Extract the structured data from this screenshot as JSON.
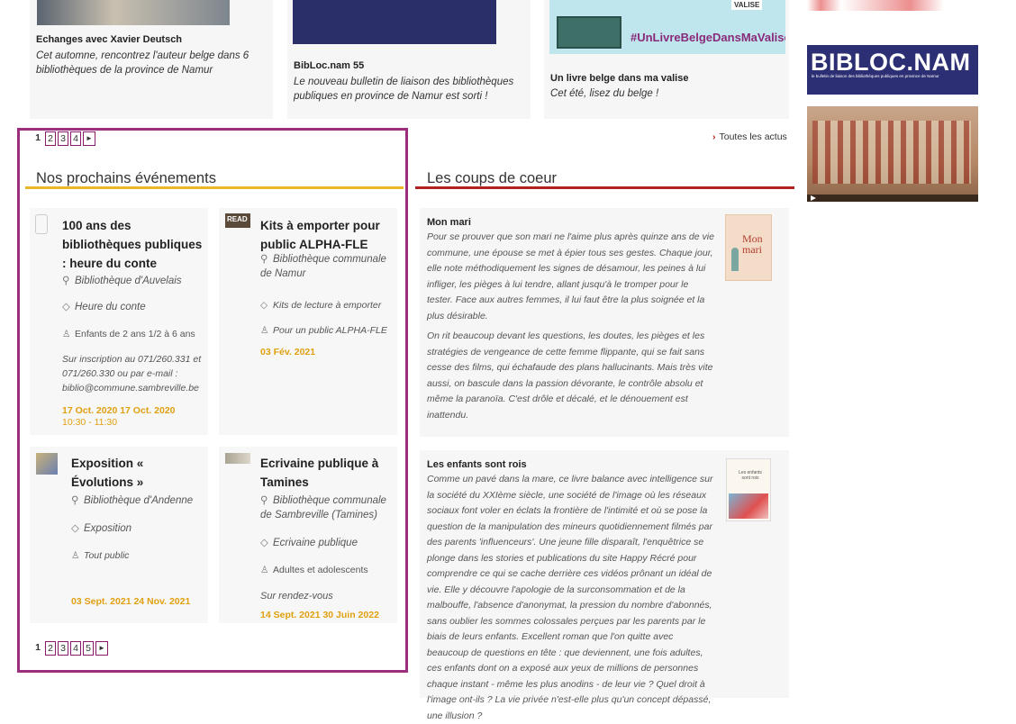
{
  "news": [
    {
      "title": "Echanges avec Xavier Deutsch",
      "desc": "Cet automne, rencontrez l'auteur belge dans 6 bibliothèques de la province de Namur"
    },
    {
      "title": "BibLoc.nam 55",
      "desc": "Le nouveau bulletin de liaison des bibliothèques publiques en province de Namur est sorti !"
    },
    {
      "title": "Un livre belge dans ma valise",
      "desc": "Cet été, lisez du belge !",
      "banner_text": "#UnLivreBelgeDansMaValise",
      "banner_tag": "VALISE"
    }
  ],
  "sidebar": {
    "bibloc_title": "BIBLOC.NAM",
    "bibloc_sub": "le bulletin de liaison des bibliothèques publiques en province de Namur"
  },
  "news_pager": {
    "pages": [
      "1",
      "2",
      "3",
      "4"
    ],
    "next": "►",
    "all_news": "Toutes les actus"
  },
  "events_section": {
    "title": "Nos prochains événements",
    "events": [
      {
        "title": "100 ans des bibliothèques publiques : heure du conte",
        "place": "Bibliothèque d'Auvelais",
        "category": "Heure du conte",
        "audience": "Enfants de 2 ans 1/2 à 6 ans",
        "note": "Sur inscription au 071/260.331 et 071/260.330 ou par e-mail : biblio@commune.sambreville.be",
        "date": "17 Oct. 2020 17 Oct. 2020",
        "time": "10:30 - 11:30"
      },
      {
        "title": "Kits à emporter pour public ALPHA-FLE",
        "place": "Bibliothèque communale de Namur",
        "category": "Kits de lecture à emporter",
        "audience": "Pour un public ALPHA-FLE",
        "date": "03 Fév. 2021",
        "thumb_text": "READ"
      },
      {
        "title": "Exposition « Évolutions »",
        "place": "Bibliothèque d'Andenne",
        "category": "Exposition",
        "audience": "Tout public",
        "date": "03 Sept. 2021 24 Nov. 2021"
      },
      {
        "title": "Ecrivaine publique à Tamines",
        "place": "Bibliothèque communale de Sambreville (Tamines)",
        "category": "Ecrivaine publique",
        "audience": "Adultes et adolescents",
        "note": "Sur rendez-vous",
        "date": "14 Sept. 2021 30 Juin 2022"
      }
    ],
    "pager": {
      "pages": [
        "1",
        "2",
        "3",
        "4",
        "5"
      ],
      "next": "►"
    }
  },
  "books_section": {
    "title": "Les coups de coeur",
    "books": [
      {
        "title": "Mon mari",
        "cover_text": "Mon mari",
        "p1": "Pour se prouver que son mari ne l'aime plus après quinze ans de vie commune, une épouse se met à épier tous ses gestes. Chaque jour, elle note méthodiquement les signes de désamour, les peines à lui infliger, les pièges à lui tendre, allant jusqu'à le tromper pour le tester. Face aux autres femmes, il lui faut être la plus soignée et la plus désirable.",
        "p2": "On rit beaucoup devant les questions, les doutes, les pièges et les stratégies de vengeance de cette femme flippante, qui se fait sans cesse des films, qui échafaude des plans hallucinants. Mais très vite aussi, on bascule dans la passion dévorante, le contrôle absolu et même la paranoïa. C'est drôle et décalé, et le dénouement est inattendu."
      },
      {
        "title": "Les enfants sont rois",
        "cover_text": "Les enfants sont rois",
        "p1": "Comme un pavé dans la mare, ce livre balance avec intelligence sur la société du XXIème siècle, une société de l'image où les réseaux sociaux font voler en éclats la frontière de l'intimité et où se pose la question de la manipulation des mineurs quotidiennement filmés par des parents 'influenceurs'. Une jeune fille disparaît, l'enquêtrice se plonge dans les stories et publications du site Happy Récré pour comprendre ce qui se cache derrière ces vidéos prônant un idéal de vie. Elle y découvre l'apologie de la surconsommation et de la malbouffe, l'absence d'anonymat, la pression du nombre d'abonnés, sans oublier les sommes colossales perçues par les parents par le biais de leurs enfants. Excellent roman que l'on quitte avec beaucoup de questions en tête : que deviennent, une fois adultes, ces enfants dont on a exposé aux yeux de millions de personnes chaque instant - même les plus anodins - de leur vie ? Quel droit à l'image ont-ils ? La vie privée n'est-elle plus qu'un concept dépassé, une illusion ?"
      }
    ]
  },
  "colors": {
    "accent_purple": "#9b2f7d",
    "events_rule": "#e8b72a",
    "books_rule": "#b22020",
    "date": "#e0a010"
  }
}
